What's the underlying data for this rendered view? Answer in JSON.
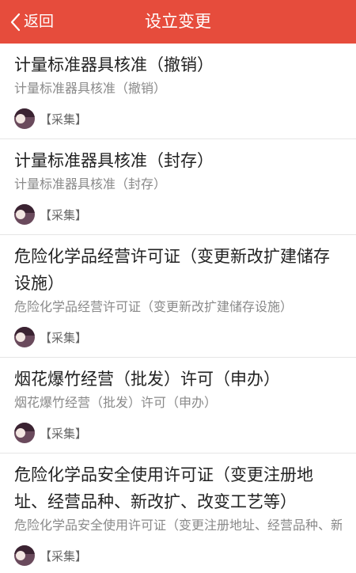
{
  "header": {
    "back_label": "返回",
    "title": "设立变更",
    "background_color": "#e64c3c"
  },
  "items": [
    {
      "title": "计量标准器具核准（撤销）",
      "subtitle": "计量标准器具核准（撤销）",
      "tag": "【采集】"
    },
    {
      "title": "计量标准器具核准（封存）",
      "subtitle": "计量标准器具核准（封存）",
      "tag": "【采集】"
    },
    {
      "title": "危险化学品经营许可证（变更新改扩建储存设施）",
      "subtitle": "危险化学品经营许可证（变更新改扩建储存设施）",
      "tag": "【采集】"
    },
    {
      "title": "烟花爆竹经营（批发）许可（申办）",
      "subtitle": "烟花爆竹经营（批发）许可（申办）",
      "tag": "【采集】"
    },
    {
      "title": "危险化学品安全使用许可证（变更注册地址、经营品种、新改扩、改变工艺等）",
      "subtitle": "危险化学品安全使用许可证（变更注册地址、经营品种、新改扩、改变工艺等）",
      "tag": "【采集】"
    }
  ]
}
